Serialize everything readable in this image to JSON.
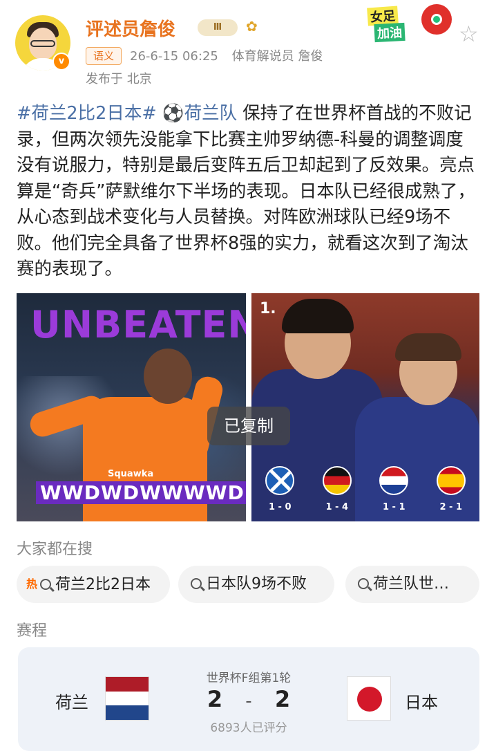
{
  "header": {
    "username": "评述员詹俊",
    "level_badge": "Ⅲ",
    "ai_badge": "语义",
    "timestamp": "26-6-15 06:25",
    "title": "体育解说员 詹俊",
    "location": "发布于 北京",
    "sticker_line1": "女足",
    "sticker_line2": "加油"
  },
  "post": {
    "hashtag": "#荷兰2比2日本#",
    "team_link": "荷兰队",
    "text": " 保持了在世界杯首战的不败记录，但两次领先没能拿下比赛主帅罗纳德-科曼的调整调度没有说服力，特别是最后变阵五后卫却起到了反效果。亮点算是“奇兵”萨默维尔下半场的表现。日本队已经很成熟了，从心态到战术变化与人员替换。对阵欧洲球队已经9场不败。他们完全具备了世界杯8强的实力，就看这次到了淘汰赛的表现了。"
  },
  "images": {
    "left_title": "UNBEATEN",
    "left_brand": "Squawka",
    "left_form": "WWDWDWWWWD",
    "right_logo": "1.",
    "right_results": [
      {
        "score": "1 - 0",
        "flag": "scotland"
      },
      {
        "score": "1 - 4",
        "flag": "germany"
      },
      {
        "score": "1 - 1",
        "flag": "croatia"
      },
      {
        "score": "2 - 1",
        "flag": "spain"
      }
    ],
    "toast": "已复制"
  },
  "search": {
    "title": "大家都在搜",
    "hot_tag": "热",
    "chips": [
      "荷兰2比2日本",
      "日本队9场不败",
      "荷兰队世…"
    ]
  },
  "schedule": {
    "title": "赛程",
    "round": "世界杯F组第1轮",
    "home": "荷兰",
    "away": "日本",
    "home_score": "2",
    "away_score": "2",
    "separator": "-",
    "rated": "6893人已评分"
  },
  "colors": {
    "accent_orange": "#e8731f",
    "link_blue": "#4a6fa5",
    "card_bg": "#eef2f8"
  }
}
